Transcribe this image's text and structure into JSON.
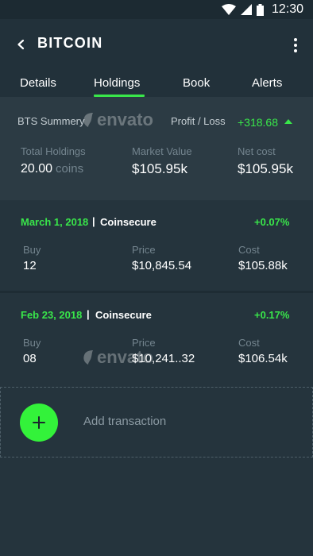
{
  "status_bar": {
    "time": "12:30"
  },
  "app_bar": {
    "title": "BITCOIN"
  },
  "tabs": [
    {
      "label": "Details"
    },
    {
      "label": "Holdings",
      "active": true
    },
    {
      "label": "Book"
    },
    {
      "label": "Alerts"
    }
  ],
  "summary": {
    "label": "BTS Summery",
    "profit_loss_label": "Profit / Loss",
    "profit_loss_value": "+318.68",
    "total_holdings_label": "Total Holdings",
    "total_holdings_value": "20.00",
    "total_holdings_unit": "coins",
    "market_value_label": "Market Value",
    "market_value": "$105.95k",
    "net_cost_label": "Net cost",
    "net_cost": "$105.95k"
  },
  "transactions": [
    {
      "date": "March 1, 2018",
      "separator": "|",
      "exchange": "Coinsecure",
      "change": "+0.07%",
      "buy_label": "Buy",
      "buy": "12",
      "price_label": "Price",
      "price": "$10,845.54",
      "cost_label": "Cost",
      "cost": "$105.88k"
    },
    {
      "date": "Feb 23, 2018",
      "separator": "|",
      "exchange": "Coinsecure",
      "change": "+0.17%",
      "buy_label": "Buy",
      "buy": "08",
      "price_label": "Price",
      "price": "$10,241..32",
      "cost_label": "Cost",
      "cost": "$106.54k"
    }
  ],
  "add_transaction": {
    "label": "Add transaction"
  },
  "watermark": {
    "text": "envato"
  },
  "colors": {
    "accent": "#39e64a",
    "fab": "#33f23a",
    "background": "#25343d",
    "app_bar": "#22313a"
  },
  "icons": [
    "back-arrow-icon",
    "more-vert-icon",
    "wifi-icon",
    "signal-icon",
    "battery-icon",
    "caret-up-icon",
    "plus-icon",
    "envato-leaf-icon"
  ]
}
